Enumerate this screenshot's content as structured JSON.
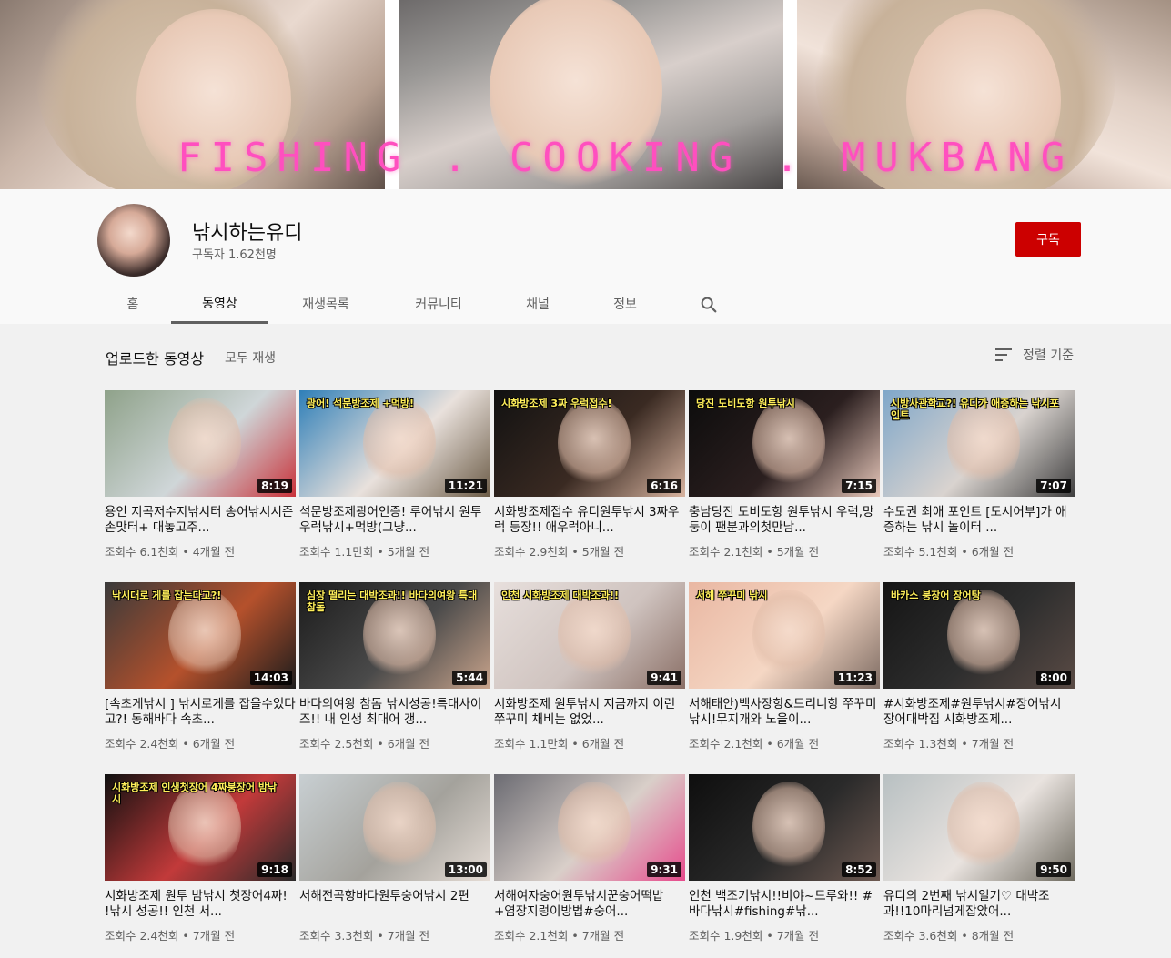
{
  "banner": {
    "text": "FISHING . COOKING . MUKBANG"
  },
  "channel": {
    "name": "낚시하는유디",
    "subscribers": "구독자 1.62천명",
    "subscribe_label": "구독"
  },
  "tabs": [
    {
      "label": "홈"
    },
    {
      "label": "동영상"
    },
    {
      "label": "재생목록"
    },
    {
      "label": "커뮤니티"
    },
    {
      "label": "채널"
    },
    {
      "label": "정보"
    }
  ],
  "section": {
    "title": "업로드한 동영상",
    "play_all": "모두 재생",
    "sort_label": "정렬 기준"
  },
  "videos": [
    {
      "title": "용인 지곡저수지낚시터 송어낚시시즌 손맛터+ 대놓고주...",
      "views": "조회수 6.1천회",
      "age": "4개월 전",
      "duration": "8:19",
      "overlay": "",
      "colors": [
        "#8fa28a",
        "#cfd6d8",
        "#c8323a"
      ]
    },
    {
      "title": "석문방조제광어인증! 루어낚시 원투우럭낚시+먹방(그냥...",
      "views": "조회수 1.1만회",
      "age": "5개월 전",
      "duration": "11:21",
      "overlay": "광어! 석문방조제 +먹방!",
      "colors": [
        "#2f7fb8",
        "#e9e1dc",
        "#6b5b46"
      ]
    },
    {
      "title": "시화방조제접수 유디원투낚시 3짜우럭 등장!! 애우럭아니...",
      "views": "조회수 2.9천회",
      "age": "5개월 전",
      "duration": "6:16",
      "overlay": "시화방조제 3짜 우럭접수!",
      "colors": [
        "#111111",
        "#3a2a22",
        "#d8b4a0"
      ]
    },
    {
      "title": "충남당진 도비도항 원투낚시 우럭,망둥이 팬분과의첫만남...",
      "views": "조회수 2.1천회",
      "age": "5개월 전",
      "duration": "7:15",
      "overlay": "당진 도비도항 원투낚시",
      "colors": [
        "#0c0c0c",
        "#2b1f1f",
        "#e8c8bb"
      ]
    },
    {
      "title": "수도권 최애 포인트 [도시어부]가 애증하는 낚시 놀이터 ...",
      "views": "조회수 5.1천회",
      "age": "6개월 전",
      "duration": "7:07",
      "overlay": "시방사관학교?! 유디가 애증하는 낚시포인트",
      "colors": [
        "#7fa7c9",
        "#d9d3cf",
        "#3f3f3f"
      ]
    },
    {
      "title": "[속초게낚시 ] 낚시로게를 잡을수있다고?! 동해바다 속초...",
      "views": "조회수 2.4천회",
      "age": "6개월 전",
      "duration": "14:03",
      "overlay": "낚시대로 게를 잡는다고?!",
      "colors": [
        "#3a3a3a",
        "#b5512c",
        "#1c1c1c"
      ]
    },
    {
      "title": "바다의여왕 참돔 낚시성공!특대사이즈!! 내 인생 최대어 갱...",
      "views": "조회수 2.5천회",
      "age": "6개월 전",
      "duration": "5:44",
      "overlay": "심장 떨리는 대박조과!! 바다의여왕 특대참돔",
      "colors": [
        "#1b1b1b",
        "#4a4a4a",
        "#c9a48c"
      ]
    },
    {
      "title": "시화방조제 원투낚시 지금까지 이런 쭈꾸미 채비는 없었...",
      "views": "조회수 1.1만회",
      "age": "6개월 전",
      "duration": "9:41",
      "overlay": "인천 시화방조제 대박조과!!",
      "colors": [
        "#e7dfdc",
        "#cfc3bf",
        "#8a6f66"
      ]
    },
    {
      "title": "서해태안)백사장항&드리니항 쭈꾸미낚시!무지개와 노을이...",
      "views": "조회수 2.1천회",
      "age": "6개월 전",
      "duration": "11:23",
      "overlay": "서해 쭈꾸미 낚시",
      "colors": [
        "#e9b7a2",
        "#f5d7c4",
        "#7e6c63"
      ]
    },
    {
      "title": "#시화방조제#원투낚시#장어낚시 장어대박집 시화방조제...",
      "views": "조회수 1.3천회",
      "age": "7개월 전",
      "duration": "8:00",
      "overlay": "바카스 붕장어 장어탕",
      "colors": [
        "#151515",
        "#2e2e2e",
        "#5a4b45"
      ]
    },
    {
      "title": "시화방조제 원투 밤낚시 첫장어4짜! !낚시 성공!! 인천 서...",
      "views": "조회수 2.4천회",
      "age": "7개월 전",
      "duration": "9:18",
      "overlay": "시화방조제 인생첫장어 4짜붕장어 밤낚시",
      "colors": [
        "#101010",
        "#c23a3a",
        "#2a2a2a"
      ]
    },
    {
      "title": "서해전곡항바다원투숭어낚시 2편",
      "views": "조회수 3.3천회",
      "age": "7개월 전",
      "duration": "13:00",
      "overlay": "",
      "colors": [
        "#c8cfd2",
        "#a4a29c",
        "#e6ddd6"
      ]
    },
    {
      "title": "서해여자숭어원투낚시꾼숭어떡밥+염장지렁이방법#숭어...",
      "views": "조회수 2.1천회",
      "age": "7개월 전",
      "duration": "9:31",
      "overlay": "",
      "colors": [
        "#6b6b72",
        "#d9cfc9",
        "#e64b8c"
      ]
    },
    {
      "title": "인천 백조기낚시!!비야~드루와!! #바다낚시#fishing#낚...",
      "views": "조회수 1.9천회",
      "age": "7개월 전",
      "duration": "8:52",
      "overlay": "",
      "colors": [
        "#0e0e0e",
        "#2a2a2a",
        "#6e5a52"
      ]
    },
    {
      "title": "유디의 2번째 낚시일기♡ 대박조과!!10마리넘게잡았어...",
      "views": "조회수 3.6천회",
      "age": "8개월 전",
      "duration": "9:50",
      "overlay": "",
      "colors": [
        "#b8c0c2",
        "#e9e3df",
        "#6e6a5f"
      ]
    }
  ]
}
